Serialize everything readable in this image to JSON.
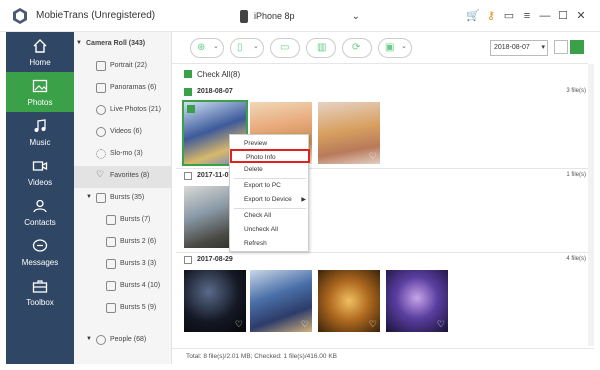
{
  "app": {
    "title": "MobieTrans (Unregistered)"
  },
  "device": {
    "name": "iPhone 8p"
  },
  "nav": [
    {
      "id": "home",
      "label": "Home"
    },
    {
      "id": "photos",
      "label": "Photos"
    },
    {
      "id": "music",
      "label": "Music"
    },
    {
      "id": "videos",
      "label": "Videos"
    },
    {
      "id": "contacts",
      "label": "Contacts"
    },
    {
      "id": "messages",
      "label": "Messages"
    },
    {
      "id": "toolbox",
      "label": "Toolbox"
    }
  ],
  "tree": {
    "root": "Camera Roll (343)",
    "items": [
      {
        "label": "Portrait (22)"
      },
      {
        "label": "Panoramas (6)"
      },
      {
        "label": "Live Photos (21)"
      },
      {
        "label": "Videos (6)"
      },
      {
        "label": "Slo-mo (3)"
      },
      {
        "label": "Favorites (8)"
      },
      {
        "label": "Bursts (35)"
      },
      {
        "label": "Bursts (7)"
      },
      {
        "label": "Bursts 2 (6)"
      },
      {
        "label": "Bursts 3 (3)"
      },
      {
        "label": "Bursts 4 (10)"
      },
      {
        "label": "Bursts 5 (9)"
      },
      {
        "label": "People (68)"
      }
    ]
  },
  "toolbar": {
    "date": "2018-08-07"
  },
  "content": {
    "check_all": "Check All(8)",
    "groups": [
      {
        "date": "2018-08-07",
        "count": "3 file(s)"
      },
      {
        "date": "2017-11-07",
        "count": "1 file(s)"
      },
      {
        "date": "2017-08-29",
        "count": "4 file(s)"
      }
    ]
  },
  "context_menu": {
    "preview": "Preview",
    "photo_info": "Photo Info",
    "delete": "Delete",
    "export_pc": "Export to PC",
    "export_device": "Export to Device",
    "check_all": "Check All",
    "uncheck_all": "Uncheck All",
    "refresh": "Refresh"
  },
  "status": {
    "text": "Total: 8 file(s)/2.01 MB; Checked: 1 file(s)/416.00 KB"
  },
  "colors": {
    "accent": "#3aa148",
    "sidebar": "#2f4664",
    "highlight": "#dd2222"
  }
}
